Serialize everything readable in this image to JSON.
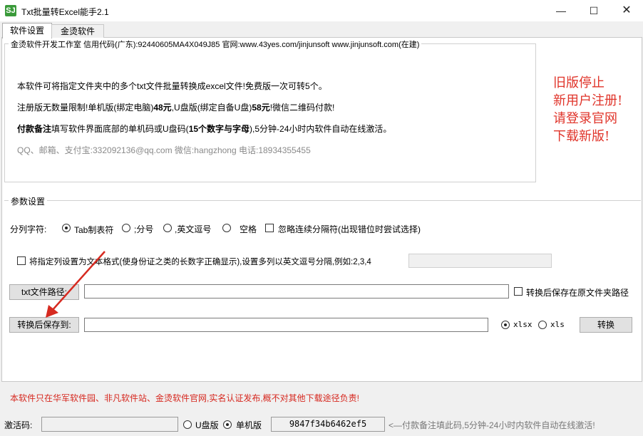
{
  "window": {
    "title": "Txt批量转Excel能手2.1",
    "icon": "app-logo-icon",
    "icon_text": "SJ",
    "minimize_glyph": "—",
    "maximize_glyph": "☐",
    "close_glyph": "✕"
  },
  "tabs": [
    {
      "label": "软件设置",
      "active": true
    },
    {
      "label": "金烫软件",
      "active": false
    }
  ],
  "info": {
    "legend": "金烫软件开发工作室 信用代码(广东):92440605MA4X049J85 官网:www.43yes.com/jinjunsoft  www.jinjunsoft.com(在建)",
    "line1": "本软件可将指定文件夹中的多个txt文件批量转换成excel文件!免费版一次可转5个。",
    "line2_a": "注册版无数量限制!单机版(绑定电脑)",
    "line2_price1": "48元",
    "line2_b": ",U盘版(绑定自备U盘)",
    "line2_price2": "58元",
    "line2_c": "!微信二维码付款!",
    "line3_bold": "付款备注",
    "line3_a": "填写软件界面底部的单机码或U盘码(",
    "line3_bold2": "15个数字与字母",
    "line3_b": "),5分钟-24小时内软件自动在线激活。",
    "line4": "QQ、邮箱、支付宝:332092136@qq.com  微信:hangzhong  电话:18934355455"
  },
  "notice": {
    "lines": [
      "旧版停止",
      "新用户注册!",
      "请登录官网",
      "下载新版!"
    ],
    "color": "#e0342a"
  },
  "params": {
    "legend": "参数设置",
    "separator_label": "分列字符:",
    "options": [
      {
        "label": "Tab制表符",
        "checked": true
      },
      {
        "label": ";分号",
        "checked": false
      },
      {
        "label": ",英文逗号",
        "checked": false
      },
      {
        "label": "空格",
        "checked": false
      }
    ],
    "ignore_consecutive_label": "忽略连续分隔符(出现错位时尝试选择)",
    "text_format_label": "将指定列设置为文本格式(使身份证之类的长数字正确显示),设置多列以英文逗号分隔,例如:2,3,4",
    "txt_path_button": "txt文件路径:",
    "txt_path_value": "",
    "keep_original_label": "转换后保存在原文件夹路径",
    "save_to_button": "转换后保存到:",
    "save_to_value": "",
    "format_options": [
      {
        "label": "xlsx",
        "checked": true
      },
      {
        "label": "xls",
        "checked": false
      }
    ],
    "convert_button": "转换"
  },
  "footer_warning": "本软件只在华军软件园、非凡软件站、金烫软件官网,实名认证发布,概不对其他下载途径负责!",
  "status": {
    "activation_label": "激活码:",
    "activation_value": "",
    "usb_label": "U盘版",
    "usb_checked": false,
    "standalone_label": "单机版",
    "standalone_checked": true,
    "machine_code": "9847f34b6462ef5",
    "hint": "<—付款备注填此码,5分钟-24小时内软件自动在线激活!"
  }
}
